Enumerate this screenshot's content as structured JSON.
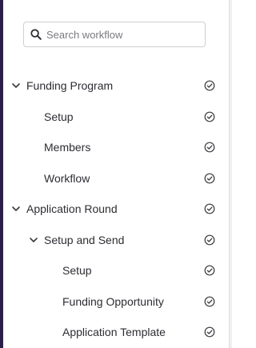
{
  "search": {
    "placeholder": "Search workflow"
  },
  "icons": {
    "search": "search-icon",
    "expand": "chevron-down-icon",
    "status": "check-circle-icon"
  },
  "colors": {
    "sidebar_edge": "#2b1f4a",
    "text": "#2d2d33",
    "icon": "#3a3a40"
  },
  "tree": [
    {
      "label": "Funding Program",
      "level": 0,
      "expanded": true
    },
    {
      "label": "Setup",
      "level": 1
    },
    {
      "label": "Members",
      "level": 1
    },
    {
      "label": "Workflow",
      "level": 1
    },
    {
      "label": "Application Round",
      "level": 0,
      "expanded": true
    },
    {
      "label": "Setup and Send",
      "level": 1,
      "expanded": true
    },
    {
      "label": "Setup",
      "level": 2
    },
    {
      "label": "Funding Opportunity",
      "level": 2
    },
    {
      "label": "Application Template",
      "level": 2
    }
  ]
}
